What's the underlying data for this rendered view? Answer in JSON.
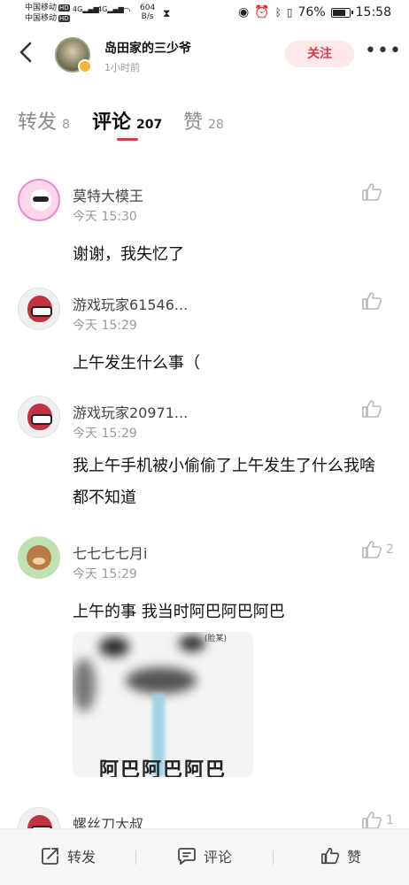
{
  "status_bar": {
    "carrier1": "中国移动",
    "carrier2": "中国移动",
    "hd": "HD",
    "signal1": "4G",
    "signal2": "4G",
    "speed_value": "604",
    "speed_unit": "B/s",
    "battery": "76%",
    "time": "15:58"
  },
  "header": {
    "author_name": "岛田家的三少爷",
    "post_time": "1小时前",
    "follow_label": "关注",
    "more_label": "•••"
  },
  "tabs": [
    {
      "label": "转发",
      "count": "8"
    },
    {
      "label": "评论",
      "count": "207"
    },
    {
      "label": "赞",
      "count": "28"
    }
  ],
  "comments": [
    {
      "name": "莫特大模王",
      "time": "今天 15:30",
      "text": "谢谢，我失忆了",
      "likes": ""
    },
    {
      "name": "游戏玩家61546...",
      "time": "今天 15:29",
      "text": "上午发生什么事（",
      "likes": ""
    },
    {
      "name": "游戏玩家20971...",
      "time": "今天 15:29",
      "text": "我上午手机被小偷偷了上午发生了什么我啥都不知道",
      "likes": ""
    },
    {
      "name": "七七七七月i",
      "time": "今天 15:29",
      "text": "上午的事 我当时阿巴阿巴阿巴",
      "likes": "2"
    },
    {
      "name": "螺丝刀大叔",
      "time": "",
      "text": "",
      "likes": "1"
    }
  ],
  "meme": {
    "text": "阿巴阿巴阿巴",
    "tag": "(脸某)"
  },
  "bottom_bar": {
    "repost": "转发",
    "comment": "评论",
    "like": "赞"
  },
  "colors": {
    "accent": "#e23a4a",
    "follow_bg": "#fde8ea"
  }
}
